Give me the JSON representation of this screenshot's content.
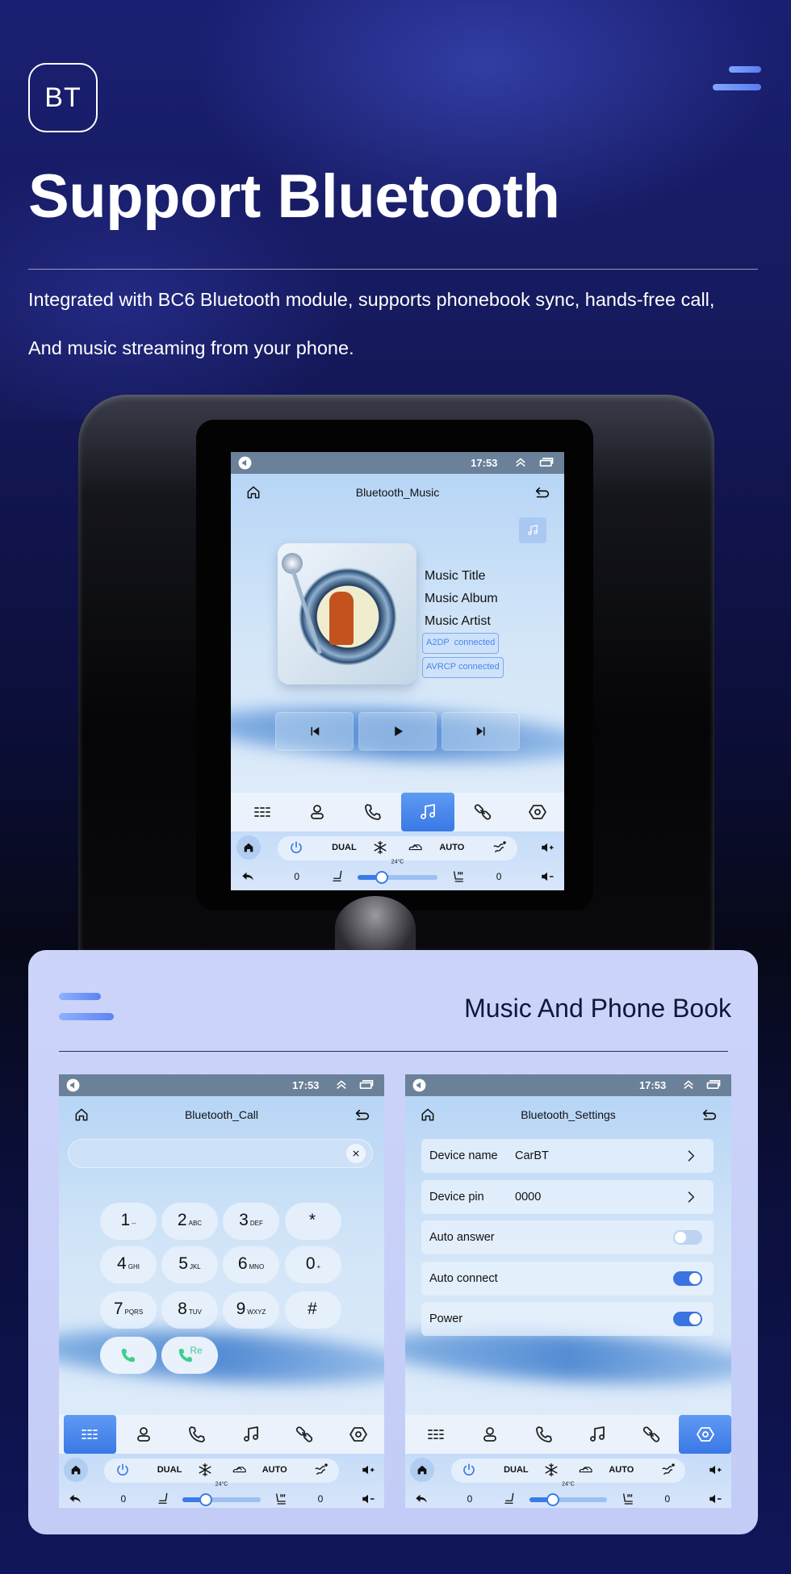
{
  "header": {
    "badge": "BT",
    "title": "Support Bluetooth",
    "desc_line1": "Integrated with BC6 Bluetooth module, supports phonebook sync, hands-free call,",
    "desc_line2": "And music streaming from your phone."
  },
  "card": {
    "title": "Music And Phone Book"
  },
  "status": {
    "time": "17:53",
    "icons": [
      "speaker-icon",
      "chevrons-up-icon",
      "window-icon"
    ]
  },
  "nav_items": [
    {
      "icon": "dialpad-icon"
    },
    {
      "icon": "contacts-icon"
    },
    {
      "icon": "phone-icon"
    },
    {
      "icon": "music-icon"
    },
    {
      "icon": "link-icon"
    },
    {
      "icon": "settings-icon"
    }
  ],
  "climate": {
    "dual": "DUAL",
    "auto": "AUTO",
    "temp": "24°C",
    "left_value": "0",
    "right_value": "0",
    "fan_level": 0.3
  },
  "music": {
    "title": "Bluetooth_Music",
    "track": "Music Title",
    "album": "Music Album",
    "artist": "Music Artist",
    "badges": [
      "A2DP  connected",
      "AVRCP connected"
    ],
    "active_nav": 3,
    "controls": [
      "previous-icon",
      "play-icon",
      "next-icon"
    ]
  },
  "call": {
    "title": "Bluetooth_Call",
    "input_value": "",
    "active_nav": 0,
    "redial_label": "Re",
    "keys": [
      {
        "d": "1",
        "l": "--"
      },
      {
        "d": "2",
        "l": "ABC"
      },
      {
        "d": "3",
        "l": "DEF"
      },
      {
        "d": "*",
        "l": ""
      },
      {
        "d": "4",
        "l": "GHI"
      },
      {
        "d": "5",
        "l": "JKL"
      },
      {
        "d": "6",
        "l": "MNO"
      },
      {
        "d": "0",
        "l": "+"
      },
      {
        "d": "7",
        "l": "PQRS"
      },
      {
        "d": "8",
        "l": "TUV"
      },
      {
        "d": "9",
        "l": "WXYZ"
      },
      {
        "d": "#",
        "l": ""
      }
    ]
  },
  "settings": {
    "title": "Bluetooth_Settings",
    "active_nav": 5,
    "rows": [
      {
        "label": "Device name",
        "value": "CarBT",
        "type": "chevron"
      },
      {
        "label": "Device pin",
        "value": "0000",
        "type": "chevron"
      },
      {
        "label": "Auto answer",
        "type": "toggle",
        "on": false
      },
      {
        "label": "Auto connect",
        "type": "toggle",
        "on": true
      },
      {
        "label": "Power",
        "type": "toggle",
        "on": true
      }
    ]
  },
  "colors": {
    "accent": "#3a78e6",
    "call_green": "#3ccf8e",
    "status_bar": "#6a8199",
    "card_bg": "#c9d2f7"
  }
}
